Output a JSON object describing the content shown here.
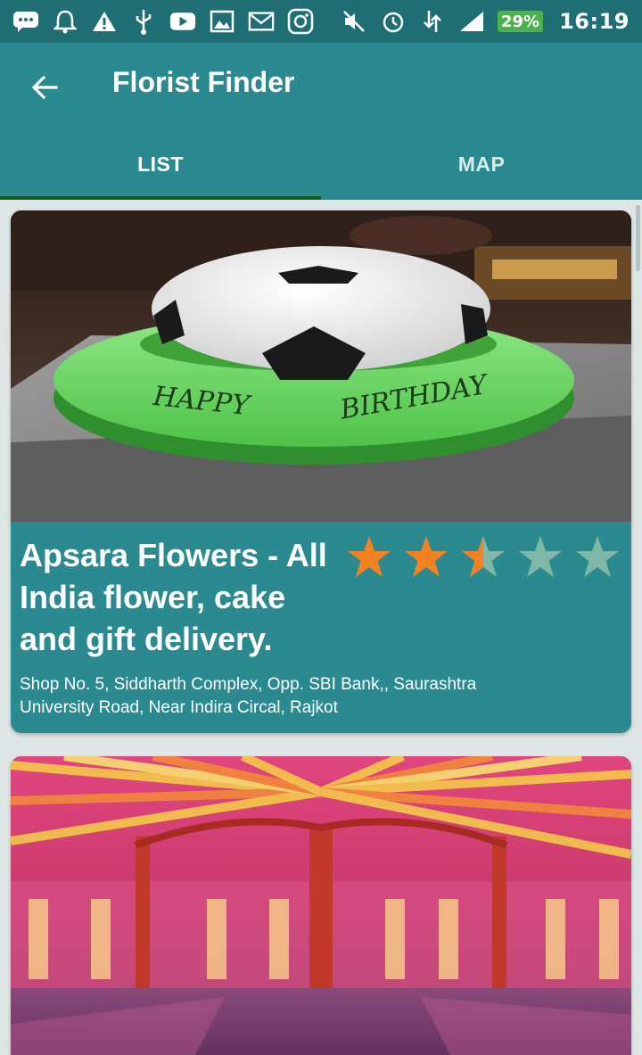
{
  "status_bar": {
    "icons_left": [
      "chat-icon",
      "download-icon",
      "alarm-icon",
      "warning-icon",
      "clipboard-icon",
      "usb-icon",
      "youtube-icon",
      "image-icon",
      "mail-icon",
      "instagram-icon"
    ],
    "icons_right": [
      "mute-icon",
      "alarm-clock-icon",
      "data-icon",
      "signal-icon",
      "sim-icon"
    ],
    "battery": "29%",
    "time": "16:19"
  },
  "app_bar": {
    "title": "Florist Finder",
    "background": "#2a8a8f"
  },
  "tabs": [
    {
      "label": "LIST",
      "selected": true
    },
    {
      "label": "MAP",
      "selected": false
    }
  ],
  "accent": {
    "star_filled": "#f5821f",
    "star_empty": "#7fb7a9",
    "tab_indicator": "#0e5c22"
  },
  "listings": [
    {
      "name": "Apsara Flowers - All India flower, cake and gift delivery.",
      "rating": 2.5,
      "rating_max": 5,
      "address": "Shop No. 5, Siddharth Complex, Opp. SBI Bank,, Saurashtra University Road, Near Indira Circal, Rajkot",
      "image": "football-cake-photo"
    },
    {
      "image": "decorated-tent-photo"
    }
  ]
}
